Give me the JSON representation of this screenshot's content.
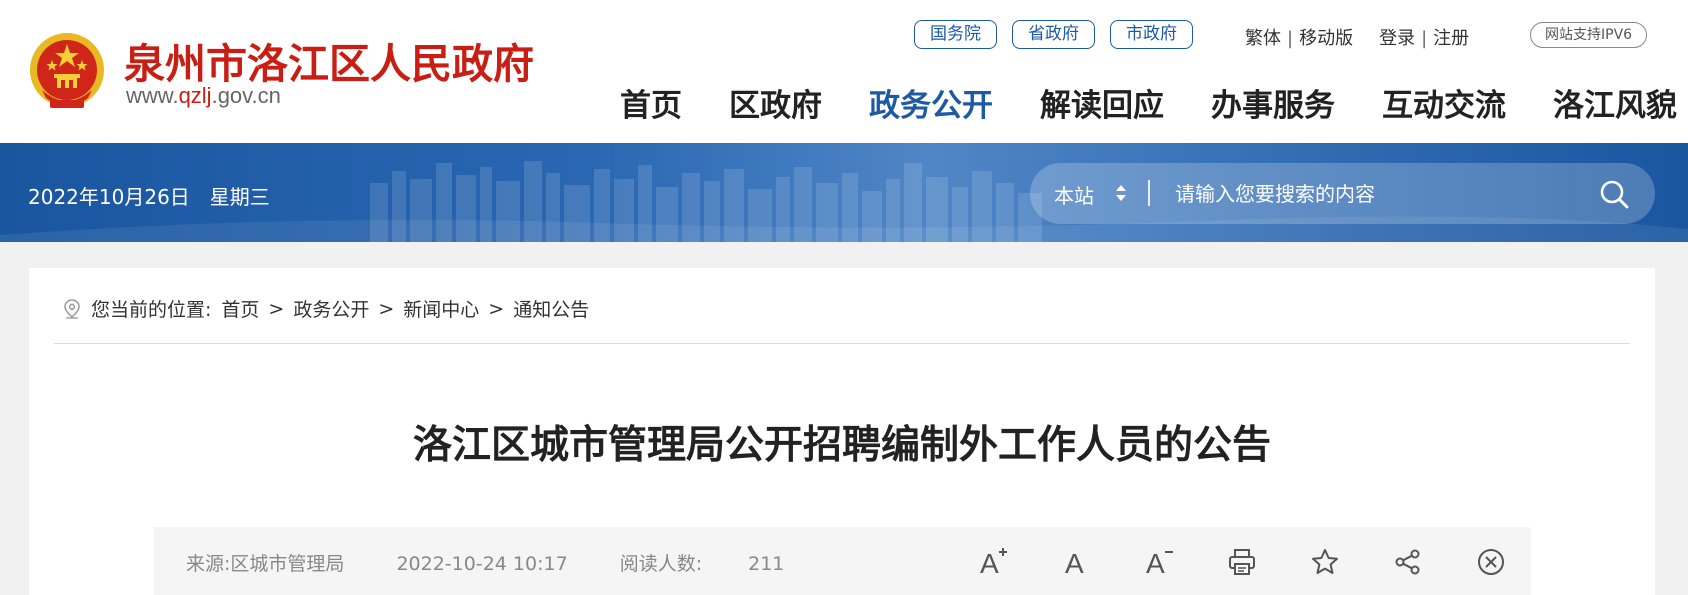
{
  "header": {
    "site_name": "泉州市洛江区人民政府",
    "domain_prefix": "www.",
    "domain_highlight": "qzlj",
    "domain_suffix": ".gov.cn",
    "gov_links": [
      "国务院",
      "省政府",
      "市政府"
    ],
    "tools": {
      "traditional": "繁体",
      "mobile": "移动版",
      "login": "登录",
      "register": "注册",
      "ipv6": "网站支持IPV6"
    },
    "nav": [
      {
        "label": "首页",
        "active": false
      },
      {
        "label": "区政府",
        "active": false
      },
      {
        "label": "政务公开",
        "active": true
      },
      {
        "label": "解读回应",
        "active": false
      },
      {
        "label": "办事服务",
        "active": false
      },
      {
        "label": "互动交流",
        "active": false
      },
      {
        "label": "洛江风貌",
        "active": false
      }
    ]
  },
  "banner": {
    "date": "2022年10月26日",
    "weekday": "星期三",
    "search": {
      "scope": "本站",
      "placeholder": "请输入您要搜索的内容"
    }
  },
  "breadcrumb": {
    "prefix": "您当前的位置:",
    "items": [
      "首页",
      "政务公开",
      "新闻中心",
      "通知公告"
    ],
    "separator": ">"
  },
  "article": {
    "title": "洛江区城市管理局公开招聘编制外工作人员的公告",
    "source": "来源:区城市管理局",
    "datetime": "2022-10-24 10:17",
    "views_label": "阅读人数:",
    "views": "211"
  },
  "actions": {
    "font_increase": "A",
    "font_reset": "A",
    "font_decrease": "A"
  },
  "icons": [
    "national-emblem-icon",
    "location-pin-icon",
    "up-down-arrows-icon",
    "search-icon",
    "font-increase-icon",
    "font-reset-icon",
    "font-decrease-icon",
    "print-icon",
    "favorite-star-icon",
    "share-icon",
    "close-circle-icon"
  ],
  "colors": {
    "brand_red": "#c81e14",
    "nav_active": "#1c5aa5",
    "banner_blue": "#1a56a0",
    "page_bg": "#f1f1f1"
  }
}
